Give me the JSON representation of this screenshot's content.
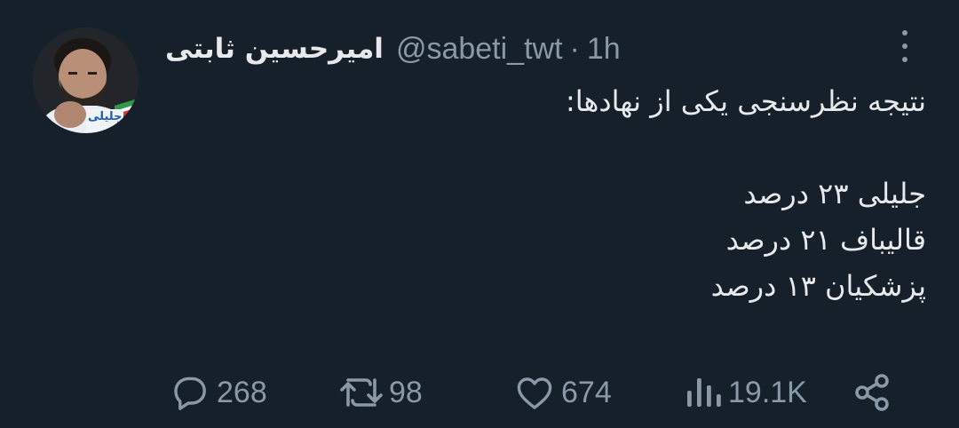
{
  "tweet": {
    "author": {
      "display_name": "امیرحسین ثابتی",
      "handle": "@sabeti_twt"
    },
    "separator": "·",
    "time": "1h",
    "body_lines": [
      "نتیجه نظرسنجی یکی از نهادها:",
      "",
      "جلیلی ۲۳ درصد",
      "قالیباف ۲۱ درصد",
      "پزشکیان ۱۳ درصد"
    ],
    "avatar_badge_text": "جلیلی"
  },
  "actions": {
    "replies": "268",
    "retweets": "98",
    "likes": "674",
    "views": "19.1K"
  },
  "colors": {
    "background": "#15202b",
    "text_primary": "#e7e9ea",
    "text_secondary": "#8b98a5"
  },
  "icons": {
    "reply": "reply-icon",
    "retweet": "retweet-icon",
    "like": "heart-icon",
    "views": "views-icon",
    "share": "share-icon",
    "more": "more-icon"
  }
}
